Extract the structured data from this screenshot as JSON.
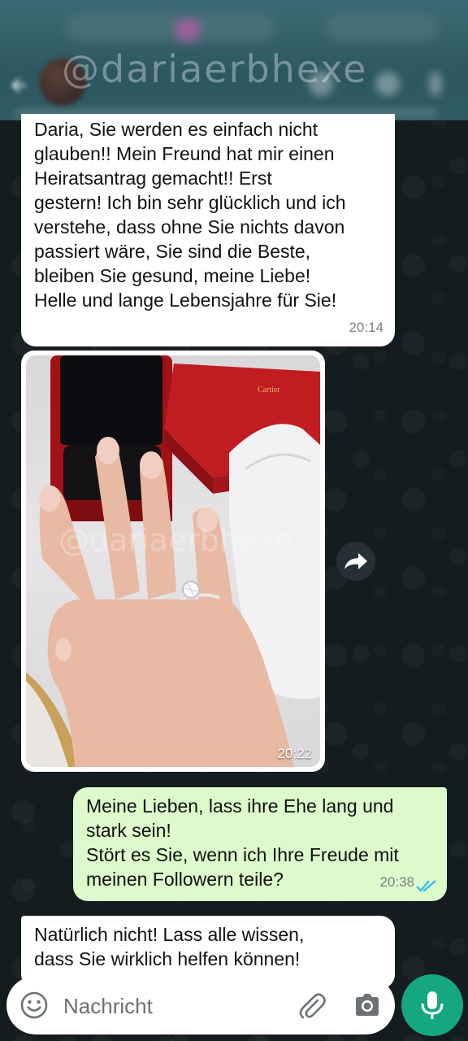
{
  "watermark": "@dariaerbhexe",
  "messages": {
    "incoming_1": {
      "text": "Daria, Sie werden es einfach nicht\nglauben!! Mein Freund hat mir einen\nHeiratsantrag gemacht!! Erst\ngestern! Ich bin sehr glücklich und ich\nverstehe, dass ohne Sie nichts davon\npassiert wäre, Sie sind die Beste,\nbleiben Sie gesund, meine Liebe!\nHelle und lange Lebensjahre für Sie!",
      "time": "20:14"
    },
    "photo": {
      "time": "20:22"
    },
    "outgoing_1": {
      "text": "Meine Lieben, lass ihre Ehe lang und\nstark sein!\nStört es Sie, wenn ich Ihre Freude mit\nmeinen Followern teile?",
      "time": "20:38",
      "status": "read"
    },
    "incoming_2": {
      "text": "Natürlich nicht! Lass alle wissen,\ndass Sie wirklich helfen können!"
    }
  },
  "composer": {
    "placeholder": "Nachricht"
  },
  "colors": {
    "outgoing_bubble": "#dcfacb",
    "incoming_bubble": "#ffffff",
    "accent": "#15a77f",
    "read_ticks": "#34b7f1"
  }
}
